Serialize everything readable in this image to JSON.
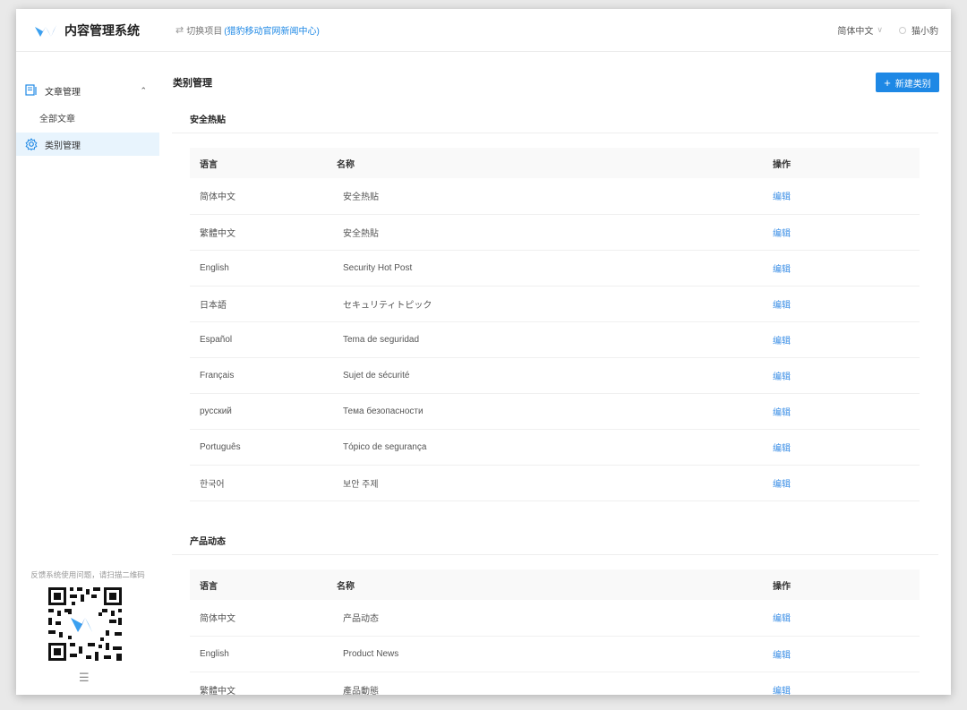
{
  "app": {
    "name": "内容管理系统"
  },
  "header": {
    "switch_label": "切换项目",
    "project": "(猎豹移动官网新闻中心)",
    "language": "简体中文",
    "user": "猫小豹"
  },
  "sidebar": {
    "group": "文章管理",
    "sub_item": "全部文章",
    "active_item": "类别管理",
    "feedback": "反馈系统使用问题，请扫描二维码"
  },
  "page": {
    "title": "类别管理",
    "new_button": "新建类别"
  },
  "sections": [
    {
      "title": "安全热贴",
      "headers": [
        "语言",
        "名称",
        "操作"
      ],
      "rows": [
        [
          "简体中文",
          "安全热贴",
          "编辑"
        ],
        [
          "繁體中文",
          "安全熱貼",
          "编辑"
        ],
        [
          "English",
          "Security Hot Post",
          "编辑"
        ],
        [
          "日本語",
          "セキュリティトピック",
          "编辑"
        ],
        [
          "Español",
          "Tema de seguridad",
          "编辑"
        ],
        [
          "Français",
          "Sujet de sécurité",
          "编辑"
        ],
        [
          "русский",
          "Тема безопасности",
          "编辑"
        ],
        [
          "Português",
          "Tópico de segurança",
          "编辑"
        ],
        [
          "한국어",
          "보안 주제",
          "编辑"
        ]
      ]
    },
    {
      "title": "产品动态",
      "headers": [
        "语言",
        "名称",
        "操作"
      ],
      "rows": [
        [
          "简体中文",
          "产品动态",
          "编辑"
        ],
        [
          "English",
          "Product News",
          "编辑"
        ],
        [
          "繁體中文",
          "產品動態",
          "编辑"
        ]
      ]
    }
  ],
  "colors": {
    "accent": "#1e88e5",
    "active_bg": "#e8f4fd"
  }
}
